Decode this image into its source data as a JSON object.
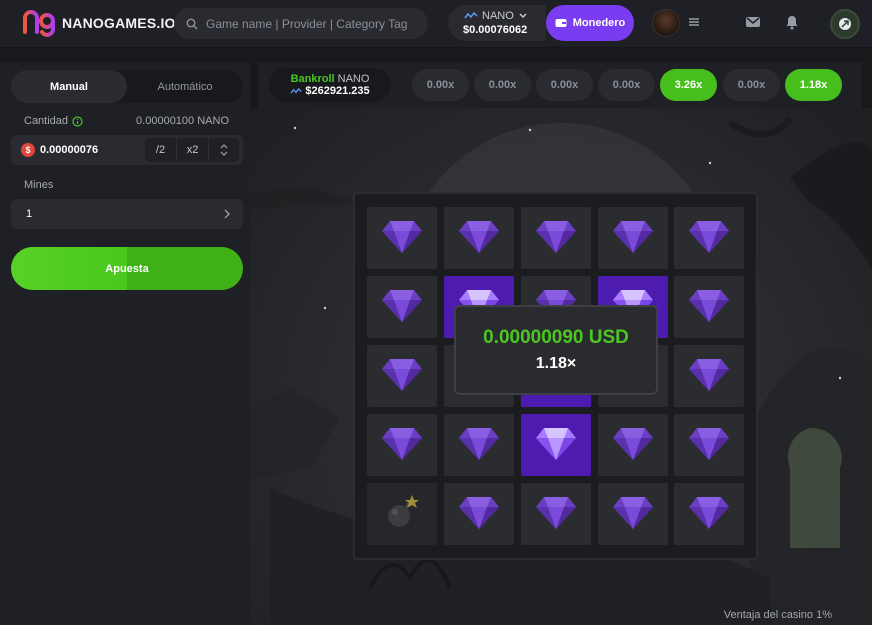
{
  "brand": {
    "name": "NANOGAMES.IO"
  },
  "search": {
    "placeholder": "Game name | Provider | Category Tag"
  },
  "balance": {
    "currency": "NANO",
    "amount": "$0.00076062"
  },
  "wallet": {
    "label": "Monedero"
  },
  "panel": {
    "tabs": [
      "Manual",
      "Automático"
    ],
    "amount_label": "Cantidad",
    "amount_min": "0.00000100 NANO",
    "amount_value": "0.00000076",
    "half_label": "/2",
    "double_label": "x2",
    "mines_label": "Mines",
    "mines_value": "1",
    "bet_label": "Apuesta",
    "bet_progress": 0.5
  },
  "bankroll": {
    "label": "Bankroll",
    "currency": "NANO",
    "amount": "$262921.235"
  },
  "history": [
    {
      "value": "0.00x",
      "win": false
    },
    {
      "value": "0.00x",
      "win": false
    },
    {
      "value": "0.00x",
      "win": false
    },
    {
      "value": "0.00x",
      "win": false
    },
    {
      "value": "3.26x",
      "win": true
    },
    {
      "value": "0.00x",
      "win": false
    },
    {
      "value": "1.18x",
      "win": true
    }
  ],
  "board": {
    "rows": [
      [
        "gem",
        "gem",
        "gem",
        "gem",
        "gem"
      ],
      [
        "gem",
        "gem-open",
        "gem",
        "gem-open",
        "gem"
      ],
      [
        "gem",
        "gem",
        "gem-open",
        "gem",
        "gem"
      ],
      [
        "gem",
        "gem",
        "gem-open",
        "gem",
        "gem"
      ],
      [
        "mine",
        "gem",
        "gem",
        "gem",
        "gem"
      ]
    ]
  },
  "result": {
    "amount": "0.00000090 USD",
    "multiplier": "1.18×"
  },
  "house_edge": "Ventaja del casino 1%",
  "colors": {
    "accent_green": "#4cc721",
    "accent_purple": "#7a3cf0",
    "gem": "#7a4ad8"
  }
}
